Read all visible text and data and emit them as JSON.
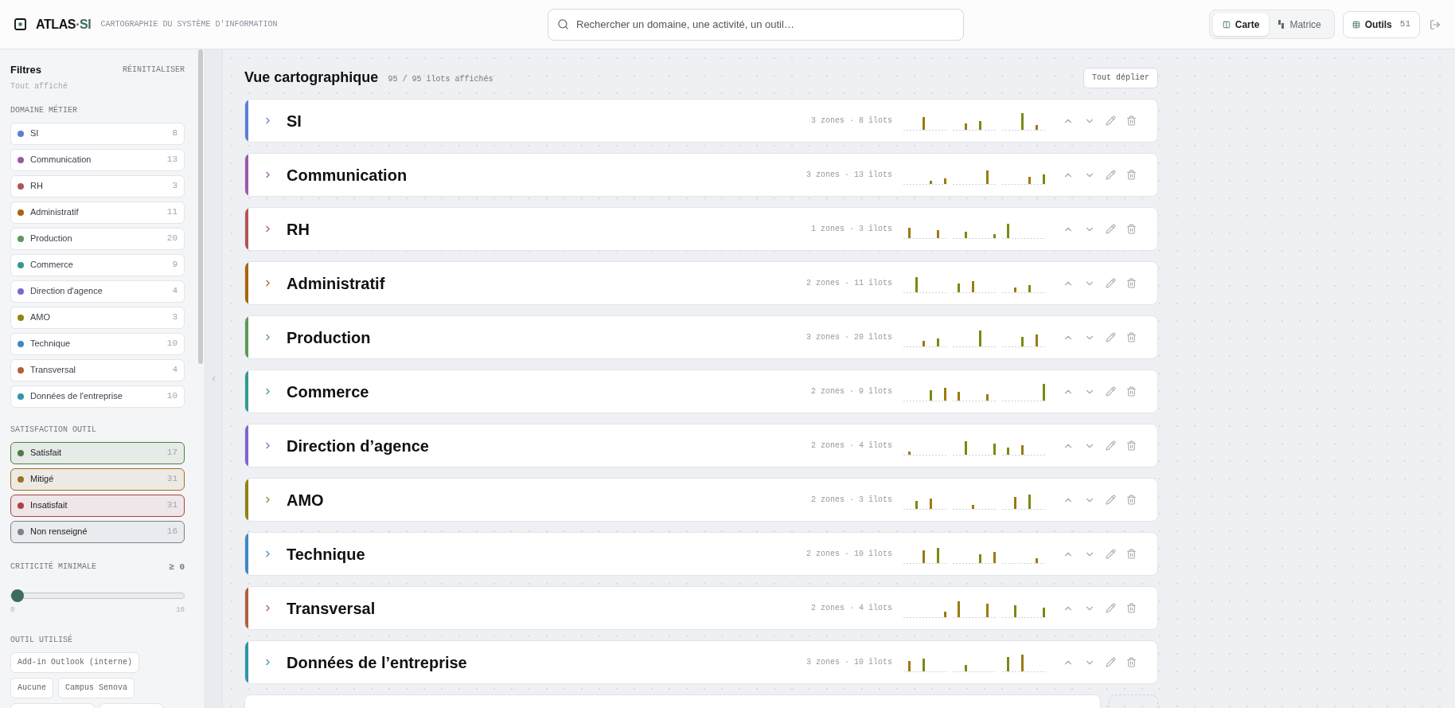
{
  "header": {
    "logo_text": "ATLAS",
    "logo_accent": "·SI",
    "subtitle": "CARTOGRAPHIE DU SYSTÈME D'INFORMATION",
    "search": {
      "placeholder": "Rechercher un domaine, une activité, un outil…"
    },
    "views": [
      {
        "label": "Carte",
        "selected": true
      },
      {
        "label": "Matrice",
        "selected": false
      }
    ],
    "tools_button": {
      "label": "Outils",
      "count": "51"
    }
  },
  "sidebar": {
    "title": "Filtres",
    "reset": "RÉINITIALISER",
    "status": "Tout affiché",
    "domain_heading": "DOMAINE MÉTIER",
    "domains": [
      {
        "label": "SI",
        "count": "8",
        "color": "#5b7fd6"
      },
      {
        "label": "Communication",
        "count": "13",
        "color": "#9b59a8"
      },
      {
        "label": "RH",
        "count": "3",
        "color": "#b05555"
      },
      {
        "label": "Administratif",
        "count": "11",
        "color": "#a8650c"
      },
      {
        "label": "Production",
        "count": "20",
        "color": "#5a9a5a"
      },
      {
        "label": "Commerce",
        "count": "9",
        "color": "#349a90"
      },
      {
        "label": "Direction d'agence",
        "count": "4",
        "color": "#7f66c9"
      },
      {
        "label": "AMO",
        "count": "3",
        "color": "#8f8410"
      },
      {
        "label": "Technique",
        "count": "10",
        "color": "#3d8ac4"
      },
      {
        "label": "Transversal",
        "count": "4",
        "color": "#b0603a"
      },
      {
        "label": "Données de l'entreprise",
        "count": "10",
        "color": "#3295a8"
      }
    ],
    "satisfaction_heading": "SATISFACTION OUTIL",
    "satisfaction": [
      {
        "label": "Satisfait",
        "count": "17",
        "color": "#4e7e45"
      },
      {
        "label": "Mitigé",
        "count": "31",
        "color": "#a0701c"
      },
      {
        "label": "Insatisfait",
        "count": "31",
        "color": "#b04040"
      },
      {
        "label": "Non renseigné",
        "count": "16",
        "color": "#808088"
      }
    ],
    "criticality": {
      "heading": "CRITICITÉ MINIMALE",
      "reading": "≥ 0",
      "level": 0,
      "min": "0",
      "max": "10"
    },
    "tools_heading": "OUTIL UTILISÉ",
    "tools": [
      "Add-in Outlook (interne)",
      "Aucune",
      "Campus Senova"
    ]
  },
  "main": {
    "title": "Vue cartographique",
    "subtitle": "95 / 95 îlots affichés",
    "expand_all": "Tout déplier",
    "rows": [
      {
        "name": "SI",
        "summary": "3 zones · 8 îlots",
        "color": "#5b7fd6"
      },
      {
        "name": "Communication",
        "summary": "3 zones · 13 îlots",
        "color": "#9b59a8"
      },
      {
        "name": "RH",
        "summary": "1 zones · 3 îlots",
        "color": "#b05555"
      },
      {
        "name": "Administratif",
        "summary": "2 zones · 11 îlots",
        "color": "#a8650c"
      },
      {
        "name": "Production",
        "summary": "3 zones · 20 îlots",
        "color": "#5a9a5a"
      },
      {
        "name": "Commerce",
        "summary": "2 zones · 9 îlots",
        "color": "#349a90"
      },
      {
        "name": "Direction d’agence",
        "summary": "2 zones · 4 îlots",
        "color": "#7f66c9"
      },
      {
        "name": "AMO",
        "summary": "2 zones · 3 îlots",
        "color": "#8f8410"
      },
      {
        "name": "Technique",
        "summary": "2 zones · 10 îlots",
        "color": "#3d8ac4"
      },
      {
        "name": "Transversal",
        "summary": "2 zones · 4 îlots",
        "color": "#b0603a"
      },
      {
        "name": "Données de l’entreprise",
        "summary": "3 zones · 10 îlots",
        "color": "#3295a8"
      }
    ]
  }
}
